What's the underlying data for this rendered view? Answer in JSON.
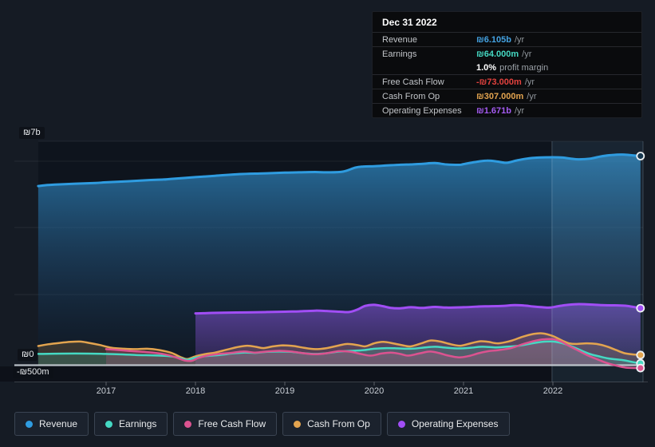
{
  "page": {
    "background": "#151b24"
  },
  "tooltip": {
    "date": "Dec 31 2022",
    "rows": {
      "revenue": {
        "label": "Revenue",
        "value": "₪6.105b",
        "unit": "/yr",
        "value_color": "#44a3e3"
      },
      "earnings": {
        "label": "Earnings",
        "value": "₪64.000m",
        "unit": "/yr",
        "value_color": "#45d9c3"
      },
      "margin": {
        "value": "1.0%",
        "text": "profit margin"
      },
      "fcf": {
        "label": "Free Cash Flow",
        "value": "-₪73.000m",
        "unit": "/yr",
        "value_color": "#e2423e"
      },
      "cash_from_op": {
        "label": "Cash From Op",
        "value": "₪307.000m",
        "unit": "/yr",
        "value_color": "#e3a44f"
      },
      "opex": {
        "label": "Operating Expenses",
        "value": "₪1.671b",
        "unit": "/yr",
        "value_color": "#a55bf2"
      }
    }
  },
  "legend": {
    "items": [
      {
        "label": "Revenue",
        "color": "#2f9ce0"
      },
      {
        "label": "Earnings",
        "color": "#45d9c3"
      },
      {
        "label": "Free Cash Flow",
        "color": "#db5390"
      },
      {
        "label": "Cash From Op",
        "color": "#e3a44f"
      },
      {
        "label": "Operating Expenses",
        "color": "#a14ef5"
      }
    ]
  },
  "chart_data": {
    "type": "area",
    "title": "",
    "currency": "₪",
    "x_axis": {
      "labels": [
        "2017",
        "2018",
        "2019",
        "2020",
        "2021",
        "2022"
      ],
      "range": [
        2016.24,
        2022.98
      ]
    },
    "y_axis": {
      "labels": [
        "₪7b",
        "₪0",
        "-₪500m"
      ],
      "unit": "billions ILS",
      "zero_label": "₪0",
      "top_label": "₪7b",
      "bottom_label": "-₪500m"
    },
    "highlight_region": {
      "from": 2021.99,
      "to": 2022.98
    },
    "series": [
      {
        "name": "Revenue",
        "color": "#2f9ce0",
        "end_value": "6.105b",
        "points": [
          [
            2016.24,
            5.23
          ],
          [
            2016.35,
            5.26
          ],
          [
            2016.48,
            5.28
          ],
          [
            2016.66,
            5.3
          ],
          [
            2016.88,
            5.32
          ],
          [
            2017.0,
            5.34
          ],
          [
            2017.24,
            5.37
          ],
          [
            2017.46,
            5.4
          ],
          [
            2017.64,
            5.42
          ],
          [
            2017.73,
            5.44
          ],
          [
            2018.0,
            5.49
          ],
          [
            2018.22,
            5.53
          ],
          [
            2018.49,
            5.58
          ],
          [
            2018.76,
            5.6
          ],
          [
            2019.0,
            5.62
          ],
          [
            2019.16,
            5.63
          ],
          [
            2019.34,
            5.64
          ],
          [
            2019.47,
            5.63
          ],
          [
            2019.65,
            5.65
          ],
          [
            2019.79,
            5.77
          ],
          [
            2019.88,
            5.8
          ],
          [
            2020.0,
            5.81
          ],
          [
            2020.14,
            5.83
          ],
          [
            2020.28,
            5.85
          ],
          [
            2020.41,
            5.86
          ],
          [
            2020.54,
            5.88
          ],
          [
            2020.68,
            5.9
          ],
          [
            2020.81,
            5.86
          ],
          [
            2020.95,
            5.85
          ],
          [
            2021.0,
            5.87
          ],
          [
            2021.13,
            5.93
          ],
          [
            2021.26,
            5.97
          ],
          [
            2021.37,
            5.95
          ],
          [
            2021.48,
            5.91
          ],
          [
            2021.6,
            5.98
          ],
          [
            2021.71,
            6.03
          ],
          [
            2021.84,
            6.06
          ],
          [
            2022.0,
            6.07
          ],
          [
            2022.11,
            6.06
          ],
          [
            2022.2,
            6.03
          ],
          [
            2022.29,
            6.01
          ],
          [
            2022.42,
            6.03
          ],
          [
            2022.53,
            6.09
          ],
          [
            2022.64,
            6.13
          ],
          [
            2022.78,
            6.15
          ],
          [
            2022.98,
            6.105
          ]
        ]
      },
      {
        "name": "Operating Expenses",
        "color": "#a14ef5",
        "end_value": "1.671b",
        "points": [
          [
            2018.0,
            1.52
          ],
          [
            2018.13,
            1.53
          ],
          [
            2018.31,
            1.54
          ],
          [
            2018.58,
            1.55
          ],
          [
            2018.8,
            1.56
          ],
          [
            2019.0,
            1.57
          ],
          [
            2019.16,
            1.58
          ],
          [
            2019.34,
            1.6
          ],
          [
            2019.47,
            1.59
          ],
          [
            2019.61,
            1.57
          ],
          [
            2019.72,
            1.56
          ],
          [
            2019.81,
            1.63
          ],
          [
            2019.9,
            1.74
          ],
          [
            2020.0,
            1.77
          ],
          [
            2020.1,
            1.73
          ],
          [
            2020.19,
            1.68
          ],
          [
            2020.29,
            1.67
          ],
          [
            2020.41,
            1.7
          ],
          [
            2020.54,
            1.68
          ],
          [
            2020.68,
            1.71
          ],
          [
            2020.81,
            1.69
          ],
          [
            2021.0,
            1.7
          ],
          [
            2021.17,
            1.72
          ],
          [
            2021.31,
            1.73
          ],
          [
            2021.44,
            1.74
          ],
          [
            2021.57,
            1.76
          ],
          [
            2021.68,
            1.75
          ],
          [
            2021.78,
            1.72
          ],
          [
            2021.88,
            1.7
          ],
          [
            2021.97,
            1.69
          ],
          [
            2022.06,
            1.73
          ],
          [
            2022.17,
            1.77
          ],
          [
            2022.29,
            1.79
          ],
          [
            2022.42,
            1.78
          ],
          [
            2022.55,
            1.76
          ],
          [
            2022.69,
            1.755
          ],
          [
            2022.83,
            1.74
          ],
          [
            2022.98,
            1.671
          ]
        ]
      },
      {
        "name": "Cash From Op",
        "color": "#e3a44f",
        "end_value": "307.000m",
        "points": [
          [
            2016.24,
            0.57
          ],
          [
            2016.35,
            0.62
          ],
          [
            2016.48,
            0.66
          ],
          [
            2016.6,
            0.69
          ],
          [
            2016.71,
            0.7
          ],
          [
            2016.81,
            0.66
          ],
          [
            2016.93,
            0.6
          ],
          [
            2017.06,
            0.52
          ],
          [
            2017.2,
            0.49
          ],
          [
            2017.33,
            0.48
          ],
          [
            2017.46,
            0.49
          ],
          [
            2017.6,
            0.45
          ],
          [
            2017.73,
            0.37
          ],
          [
            2017.85,
            0.23
          ],
          [
            2017.91,
            0.19
          ],
          [
            2018.0,
            0.27
          ],
          [
            2018.12,
            0.34
          ],
          [
            2018.22,
            0.38
          ],
          [
            2018.36,
            0.47
          ],
          [
            2018.49,
            0.55
          ],
          [
            2018.58,
            0.58
          ],
          [
            2018.67,
            0.55
          ],
          [
            2018.76,
            0.51
          ],
          [
            2018.87,
            0.56
          ],
          [
            2018.98,
            0.59
          ],
          [
            2019.1,
            0.57
          ],
          [
            2019.21,
            0.52
          ],
          [
            2019.34,
            0.48
          ],
          [
            2019.47,
            0.51
          ],
          [
            2019.61,
            0.59
          ],
          [
            2019.7,
            0.63
          ],
          [
            2019.81,
            0.6
          ],
          [
            2019.9,
            0.56
          ],
          [
            2020.0,
            0.65
          ],
          [
            2020.1,
            0.69
          ],
          [
            2020.21,
            0.65
          ],
          [
            2020.32,
            0.59
          ],
          [
            2020.41,
            0.56
          ],
          [
            2020.53,
            0.65
          ],
          [
            2020.63,
            0.73
          ],
          [
            2020.74,
            0.7
          ],
          [
            2020.86,
            0.62
          ],
          [
            2020.97,
            0.58
          ],
          [
            2021.08,
            0.65
          ],
          [
            2021.19,
            0.71
          ],
          [
            2021.28,
            0.69
          ],
          [
            2021.39,
            0.65
          ],
          [
            2021.53,
            0.72
          ],
          [
            2021.66,
            0.84
          ],
          [
            2021.78,
            0.92
          ],
          [
            2021.88,
            0.94
          ],
          [
            2022.0,
            0.86
          ],
          [
            2022.11,
            0.72
          ],
          [
            2022.18,
            0.65
          ],
          [
            2022.26,
            0.63
          ],
          [
            2022.38,
            0.65
          ],
          [
            2022.49,
            0.63
          ],
          [
            2022.6,
            0.56
          ],
          [
            2022.71,
            0.45
          ],
          [
            2022.82,
            0.35
          ],
          [
            2022.98,
            0.307
          ]
        ]
      },
      {
        "name": "Earnings",
        "color": "#45d9c3",
        "end_value": "64.000m",
        "points": [
          [
            2016.24,
            0.34
          ],
          [
            2016.66,
            0.35
          ],
          [
            2017.0,
            0.34
          ],
          [
            2017.33,
            0.31
          ],
          [
            2017.69,
            0.28
          ],
          [
            2017.82,
            0.22
          ],
          [
            2017.91,
            0.17
          ],
          [
            2018.0,
            0.23
          ],
          [
            2018.13,
            0.28
          ],
          [
            2018.27,
            0.31
          ],
          [
            2018.4,
            0.35
          ],
          [
            2018.54,
            0.38
          ],
          [
            2018.67,
            0.37
          ],
          [
            2018.8,
            0.4
          ],
          [
            2018.94,
            0.41
          ],
          [
            2019.07,
            0.4
          ],
          [
            2019.21,
            0.36
          ],
          [
            2019.34,
            0.34
          ],
          [
            2019.47,
            0.36
          ],
          [
            2019.61,
            0.41
          ],
          [
            2019.74,
            0.43
          ],
          [
            2019.88,
            0.45
          ],
          [
            2020.0,
            0.49
          ],
          [
            2020.14,
            0.51
          ],
          [
            2020.28,
            0.5
          ],
          [
            2020.41,
            0.49
          ],
          [
            2020.54,
            0.52
          ],
          [
            2020.68,
            0.55
          ],
          [
            2020.81,
            0.52
          ],
          [
            2020.95,
            0.5
          ],
          [
            2021.08,
            0.52
          ],
          [
            2021.21,
            0.55
          ],
          [
            2021.35,
            0.53
          ],
          [
            2021.48,
            0.55
          ],
          [
            2021.62,
            0.58
          ],
          [
            2021.75,
            0.64
          ],
          [
            2021.88,
            0.69
          ],
          [
            2022.0,
            0.7
          ],
          [
            2022.11,
            0.65
          ],
          [
            2022.2,
            0.57
          ],
          [
            2022.29,
            0.47
          ],
          [
            2022.4,
            0.35
          ],
          [
            2022.53,
            0.26
          ],
          [
            2022.64,
            0.2
          ],
          [
            2022.78,
            0.16
          ],
          [
            2022.9,
            0.1
          ],
          [
            2022.98,
            0.064
          ]
        ]
      },
      {
        "name": "Free Cash Flow",
        "color": "#db5390",
        "end_value": "-73.000m",
        "points": [
          [
            2017.0,
            0.48
          ],
          [
            2017.15,
            0.45
          ],
          [
            2017.29,
            0.42
          ],
          [
            2017.42,
            0.4
          ],
          [
            2017.55,
            0.37
          ],
          [
            2017.69,
            0.31
          ],
          [
            2017.79,
            0.23
          ],
          [
            2017.88,
            0.15
          ],
          [
            2017.96,
            0.14
          ],
          [
            2018.03,
            0.22
          ],
          [
            2018.13,
            0.29
          ],
          [
            2018.27,
            0.34
          ],
          [
            2018.4,
            0.37
          ],
          [
            2018.54,
            0.41
          ],
          [
            2018.67,
            0.38
          ],
          [
            2018.8,
            0.41
          ],
          [
            2018.94,
            0.43
          ],
          [
            2019.07,
            0.41
          ],
          [
            2019.21,
            0.36
          ],
          [
            2019.34,
            0.33
          ],
          [
            2019.47,
            0.36
          ],
          [
            2019.61,
            0.42
          ],
          [
            2019.74,
            0.4
          ],
          [
            2019.85,
            0.34
          ],
          [
            2019.96,
            0.29
          ],
          [
            2020.08,
            0.35
          ],
          [
            2020.19,
            0.38
          ],
          [
            2020.29,
            0.34
          ],
          [
            2020.38,
            0.29
          ],
          [
            2020.5,
            0.35
          ],
          [
            2020.62,
            0.41
          ],
          [
            2020.72,
            0.37
          ],
          [
            2020.83,
            0.29
          ],
          [
            2020.95,
            0.24
          ],
          [
            2021.06,
            0.28
          ],
          [
            2021.17,
            0.36
          ],
          [
            2021.28,
            0.42
          ],
          [
            2021.39,
            0.45
          ],
          [
            2021.53,
            0.51
          ],
          [
            2021.66,
            0.62
          ],
          [
            2021.78,
            0.71
          ],
          [
            2021.88,
            0.76
          ],
          [
            2022.0,
            0.77
          ],
          [
            2022.09,
            0.7
          ],
          [
            2022.17,
            0.59
          ],
          [
            2022.26,
            0.47
          ],
          [
            2022.38,
            0.31
          ],
          [
            2022.49,
            0.19
          ],
          [
            2022.6,
            0.08
          ],
          [
            2022.71,
            0.0
          ],
          [
            2022.82,
            -0.06
          ],
          [
            2022.98,
            -0.073
          ]
        ]
      }
    ]
  }
}
